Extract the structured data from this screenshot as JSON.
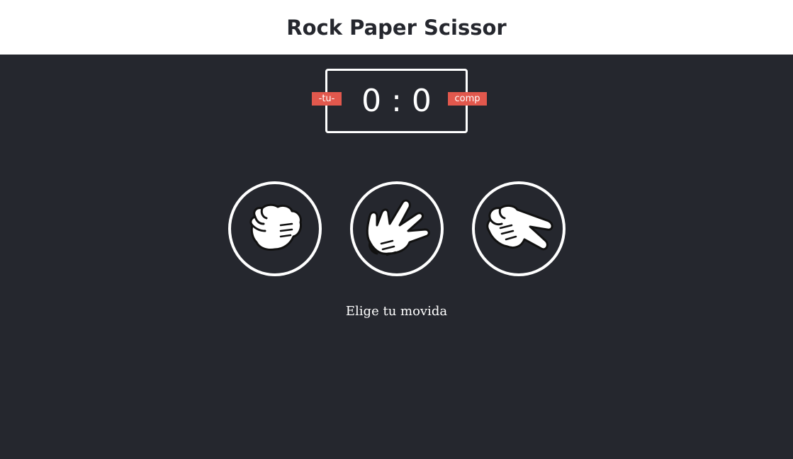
{
  "header": {
    "title": "Rock Paper Scissor"
  },
  "scoreboard": {
    "user_label": "-tu-",
    "comp_label": "comp",
    "user_score": "0",
    "separator": ":",
    "comp_score": "0"
  },
  "choices": [
    {
      "name": "rock",
      "icon": "rock-hand-icon"
    },
    {
      "name": "paper",
      "icon": "paper-hand-icon"
    },
    {
      "name": "scissors",
      "icon": "scissors-hand-icon"
    }
  ],
  "message": "Elige tu movida",
  "colors": {
    "background": "#25272e",
    "header_bg": "#ffffff",
    "accent": "#e2584d",
    "foreground": "#ffffff"
  }
}
